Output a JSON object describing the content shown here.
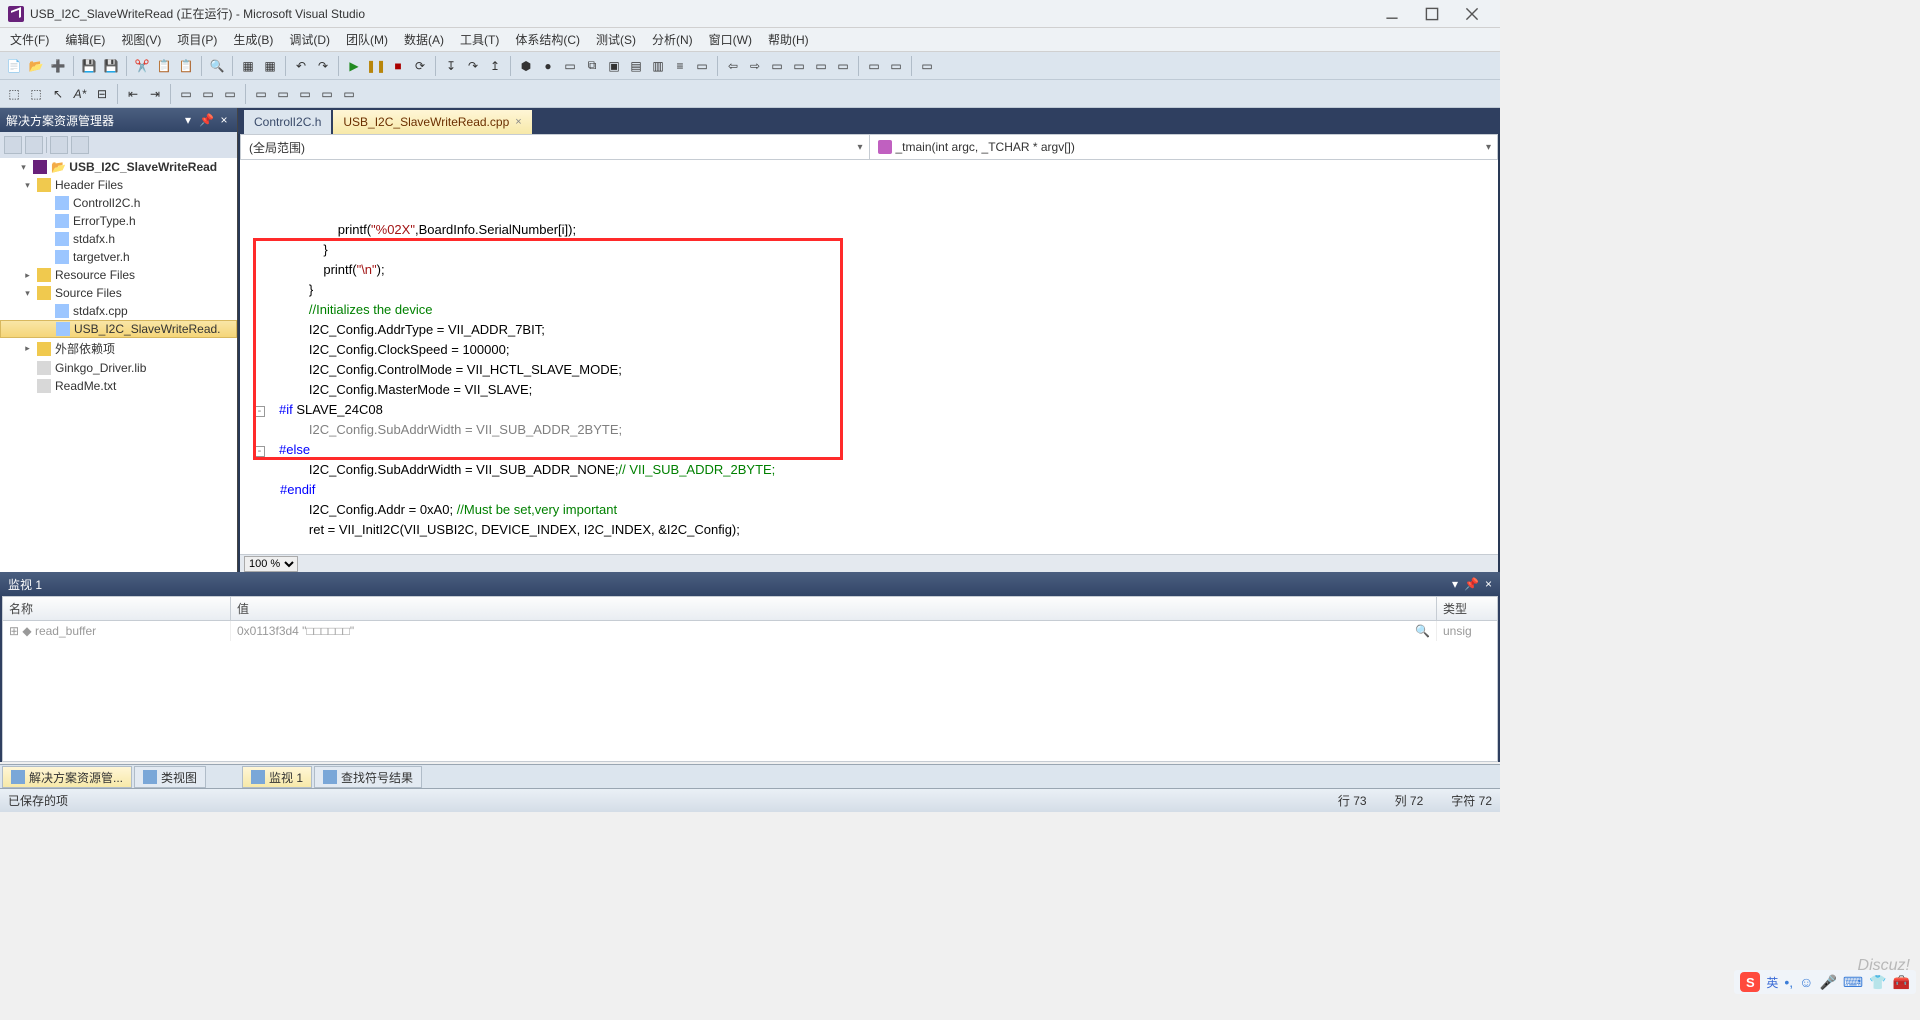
{
  "window": {
    "title": "USB_I2C_SlaveWriteRead (正在运行) - Microsoft Visual Studio"
  },
  "menu": [
    "文件(F)",
    "编辑(E)",
    "视图(V)",
    "项目(P)",
    "生成(B)",
    "调试(D)",
    "团队(M)",
    "数据(A)",
    "工具(T)",
    "体系结构(C)",
    "测试(S)",
    "分析(N)",
    "窗口(W)",
    "帮助(H)"
  ],
  "solution_explorer": {
    "title": "解决方案资源管理器",
    "root": "USB_I2C_SlaveWriteRead",
    "folders": [
      {
        "name": "Header Files",
        "expanded": true,
        "items": [
          "ControlI2C.h",
          "ErrorType.h",
          "stdafx.h",
          "targetver.h"
        ]
      },
      {
        "name": "Resource Files",
        "expanded": false,
        "items": []
      },
      {
        "name": "Source Files",
        "expanded": true,
        "items": [
          "stdafx.cpp",
          "USB_I2C_SlaveWriteRead."
        ]
      },
      {
        "name": "外部依赖项",
        "expanded": false,
        "items": []
      }
    ],
    "loose": [
      "Ginkgo_Driver.lib",
      "ReadMe.txt"
    ],
    "selected": "USB_I2C_SlaveWriteRead."
  },
  "editor": {
    "tabs": [
      {
        "label": "ControlI2C.h",
        "active": false
      },
      {
        "label": "USB_I2C_SlaveWriteRead.cpp",
        "active": true
      }
    ],
    "scope_dd": "(全局范围)",
    "member_dd": "_tmain(int argc, _TCHAR * argv[])",
    "zoom": "100 %",
    "code_lines": [
      {
        "t": "                printf(\"%02X\",BoardInfo.SerialNumber[i]);",
        "seg": [
          [
            "plain",
            "                printf("
          ],
          [
            "str",
            "\"%02X\""
          ],
          [
            "plain",
            ",BoardInfo.SerialNumber[i]);"
          ]
        ]
      },
      {
        "t": "            }",
        "seg": [
          [
            "plain",
            "            }"
          ]
        ]
      },
      {
        "t": "            printf(\"\\n\");",
        "seg": [
          [
            "plain",
            "            printf("
          ],
          [
            "str",
            "\"\\n\""
          ],
          [
            "plain",
            ");"
          ]
        ]
      },
      {
        "t": "        }",
        "seg": [
          [
            "plain",
            "        }"
          ]
        ]
      },
      {
        "t": "        //Initializes the device",
        "seg": [
          [
            "plain",
            "        "
          ],
          [
            "cmt",
            "//Initializes the device"
          ]
        ]
      },
      {
        "t": "        I2C_Config.AddrType = VII_ADDR_7BIT;",
        "seg": [
          [
            "plain",
            "        I2C_Config.AddrType = VII_ADDR_7BIT;"
          ]
        ]
      },
      {
        "t": "        I2C_Config.ClockSpeed = 100000;",
        "seg": [
          [
            "plain",
            "        I2C_Config.ClockSpeed = 100000;"
          ]
        ]
      },
      {
        "t": "        I2C_Config.ControlMode = VII_HCTL_SLAVE_MODE;",
        "seg": [
          [
            "plain",
            "        I2C_Config.ControlMode = VII_HCTL_SLAVE_MODE;"
          ]
        ]
      },
      {
        "t": "        I2C_Config.MasterMode = VII_SLAVE;",
        "seg": [
          [
            "plain",
            "        I2C_Config.MasterMode = VII_SLAVE;"
          ]
        ]
      },
      {
        "t": "#if SLAVE_24C08",
        "fold": "-",
        "seg": [
          [
            "pp",
            "#if"
          ],
          [
            "plain",
            " SLAVE_24C08"
          ]
        ]
      },
      {
        "t": "        I2C_Config.SubAddrWidth = VII_SUB_ADDR_2BYTE;",
        "seg": [
          [
            "ppgray",
            "        I2C_Config.SubAddrWidth = VII_SUB_ADDR_2BYTE;"
          ]
        ]
      },
      {
        "t": "#else",
        "fold": "-",
        "seg": [
          [
            "pp",
            "#else"
          ]
        ]
      },
      {
        "t": "        I2C_Config.SubAddrWidth = VII_SUB_ADDR_NONE;// VII_SUB_ADDR_2BYTE;",
        "seg": [
          [
            "plain",
            "        I2C_Config.SubAddrWidth = VII_SUB_ADDR_NONE;"
          ],
          [
            "cmt",
            "// VII_SUB_ADDR_2BYTE;"
          ]
        ]
      },
      {
        "t": "#endif",
        "seg": [
          [
            "pp",
            "#endif"
          ]
        ]
      },
      {
        "t": "        I2C_Config.Addr = 0xA0; //Must be set,very important",
        "seg": [
          [
            "plain",
            "        I2C_Config.Addr = 0xA0; "
          ],
          [
            "cmt",
            "//Must be set,very important"
          ]
        ]
      },
      {
        "t": "        ret = VII_InitI2C(VII_USBI2C, DEVICE_INDEX, I2C_INDEX, &I2C_Config);",
        "seg": [
          [
            "plain",
            "        ret = VII_InitI2C(VII_USBI2C, DEVICE_INDEX, I2C_INDEX, &I2C_Config);"
          ]
        ]
      }
    ]
  },
  "watch": {
    "title": "监视 1",
    "columns": {
      "name": "名称",
      "value": "值",
      "type": "类型"
    },
    "rows": [
      {
        "name": "read_buffer",
        "value": "0x0113f3d4 \"□□□□□□\"",
        "type": "unsig"
      }
    ]
  },
  "bottom_tabs_left": [
    {
      "label": "解决方案资源管...",
      "active": true
    },
    {
      "label": "类视图",
      "active": false
    }
  ],
  "bottom_tabs_right": [
    {
      "label": "监视 1",
      "active": true
    },
    {
      "label": "查找符号结果",
      "active": false
    }
  ],
  "status": {
    "left": "已保存的项",
    "line_lbl": "行",
    "line": "73",
    "col_lbl": "列",
    "col": "72",
    "char_lbl": "字符",
    "char": "72"
  },
  "ime": {
    "lang": "英"
  },
  "brand": "Discuz!"
}
